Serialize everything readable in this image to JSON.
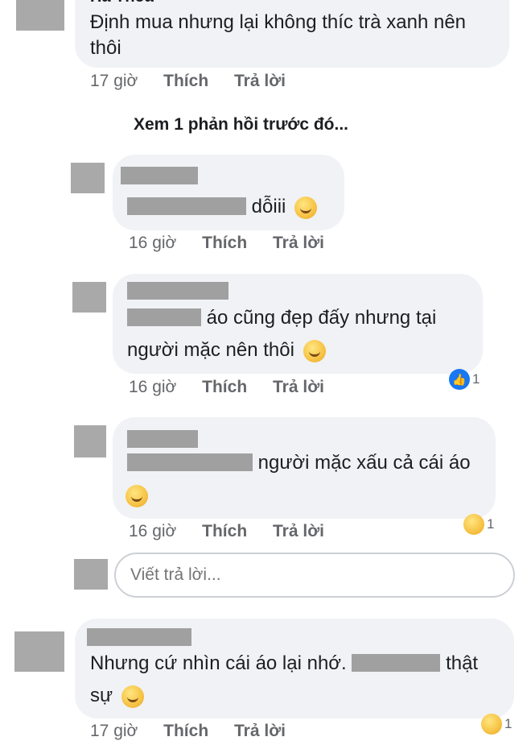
{
  "comments": [
    {
      "author_partial": "Hà Thoa",
      "text_lines": [
        "Định mua nhưng lại không thíc trà xanh nên",
        "thôi"
      ],
      "time": "17 giờ",
      "like": "Thích",
      "reply": "Trả lời"
    },
    {
      "view_more": "Xem 1 phản hồi trước đó...",
      "text_suffix": "dỗiii",
      "time": "16 giờ",
      "like": "Thích",
      "reply": "Trả lời"
    },
    {
      "text_line1_suffix": "áo cũng đẹp đấy nhưng tại",
      "text_line2": "người mặc nên thôi",
      "time": "16 giờ",
      "like": "Thích",
      "reply": "Trả lời",
      "reaction_count": "1"
    },
    {
      "text_line1_suffix": "người mặc xấu cả cái áo",
      "time": "16 giờ",
      "like": "Thích",
      "reply": "Trả lời",
      "reaction_count": "1"
    },
    {
      "text_line1_prefix": "Nhưng cứ nhìn cái áo lại nhớ.",
      "text_line1_suffix": "thật",
      "text_line2": "sự",
      "time": "17 giờ",
      "like": "Thích",
      "reply": "Trả lời",
      "reaction_count": "1"
    }
  ],
  "reply_box": {
    "placeholder": "Viết trả lời..."
  },
  "colors": {
    "bubble": "#f0f2f5",
    "redaction": "#a0a0a0",
    "like_blue": "#1877f2",
    "meta_gray": "#65676b"
  },
  "icons": {
    "like": "thumbs-up-icon",
    "laugh": "laugh-reaction-icon",
    "emoji": "smiley-emoji-icon"
  }
}
